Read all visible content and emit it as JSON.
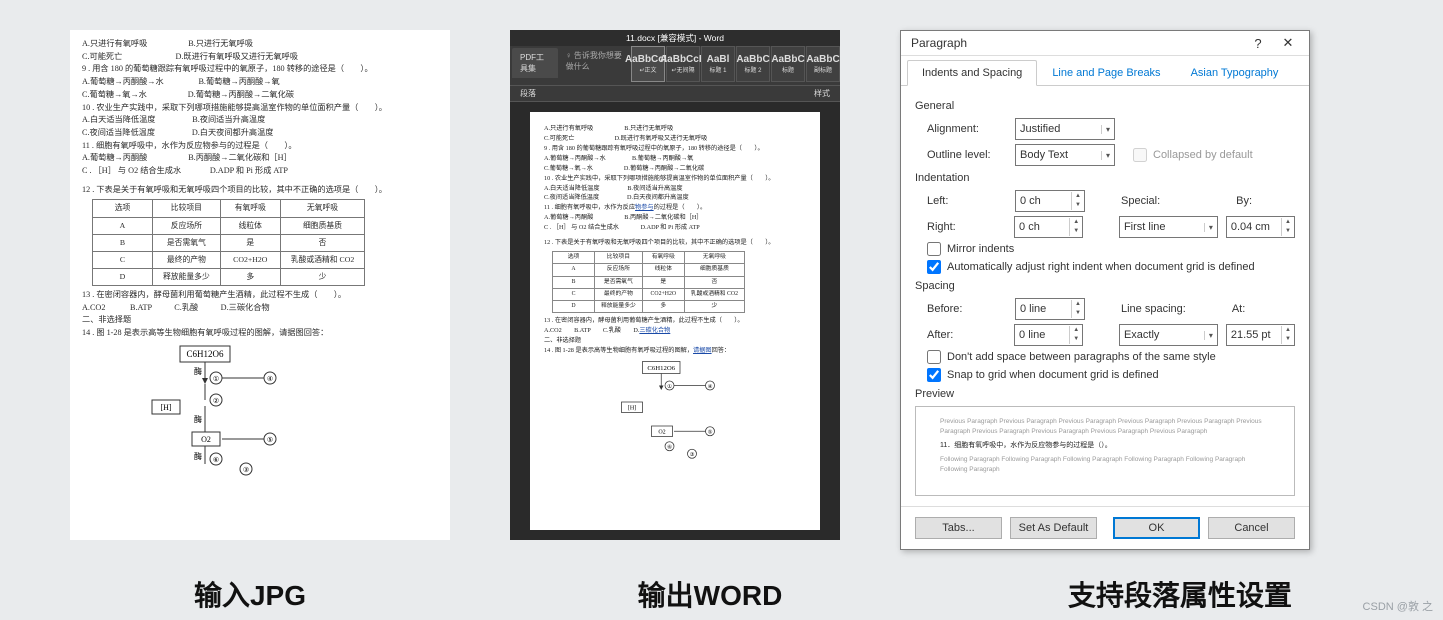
{
  "captions": {
    "jpg": "输入JPG",
    "word": "输出WORD",
    "dialog": "支持段落属性设置"
  },
  "watermark": "CSDN @敦 之",
  "doc": {
    "l1": "A.只进行有氧呼吸                    B.只进行无氧呼吸",
    "l2": "C.可能死亡                          D.既进行有氧呼吸又进行无氧呼吸",
    "l3": "9 . 用含 180 的葡萄糖跟踪有氧呼吸过程中的氧原子，180 转移的途径是（　　）。",
    "l4": "A.葡萄糖→丙酮酸→水                 B.葡萄糖→丙酮酸→氧",
    "l5": "C.葡萄糖→氧→水                    D.葡萄糖→丙酮酸→二氧化碳",
    "l6": "10 . 农业生产实践中，采取下列哪项措施能够提高温室作物的单位面积产量（　　）。",
    "l7": "A.白天适当降低温度                  B.夜间适当升高温度",
    "l8": "C.夜间适当降低温度                  D.白天夜间都升高温度",
    "l9": "11 . 细胞有氧呼吸中，水作为反应物参与的过程是（　　）。",
    "l10": "A.葡萄糖→丙酮酸                    B.丙酮酸→二氧化碳和［H］",
    "l11": "C . ［H］ 与 O2 结合生成水              D.ADP 和 Pi 形成 ATP",
    "l12": "12 . 下表是关于有氧呼吸和无氧呼吸四个项目的比较，其中不正确的选项是（　　）。",
    "th": [
      "选项",
      "比较项目",
      "有氧呼吸",
      "无氧呼吸"
    ],
    "tA": [
      "A",
      "反应场所",
      "线粒体",
      "细胞质基质"
    ],
    "tB": [
      "B",
      "是否需氧气",
      "是",
      "否"
    ],
    "tC": [
      "C",
      "最终的产物",
      "CO2+H2O",
      "乳酸或酒精和 CO2"
    ],
    "tD": [
      "D",
      "释放能量多少",
      "多",
      "少"
    ],
    "l13": "13 . 在密闭容器内，酵母菌利用葡萄糖产生酒精，此过程不生成（　　）。",
    "l14": "A.CO2            B.ATP           C.乳酸           D.三碳化合物",
    "l15": "二、非选择题",
    "l16": "14 . 图 1-28 是表示高等生物细胞有氧呼吸过程的图解，请据图回答：",
    "diagram_labels": {
      "top": "C6H12O6",
      "enzyme": "酶",
      "o2": "O2",
      "h": "[H]",
      "n1": "①",
      "n2": "②",
      "n3": "③",
      "n4": "④",
      "n5": "⑤",
      "n6": "⑥"
    }
  },
  "word": {
    "title": "11.docx [兼容模式] - Word",
    "tab_pdf": "PDF工具集",
    "tell_me": "♀ 告诉我你想要做什么",
    "styles": [
      {
        "sample": "AaBbCcD",
        "label": "↵正文"
      },
      {
        "sample": "AaBbCcD",
        "label": "↵无间隔"
      },
      {
        "sample": "AaBl",
        "label": "标题 1"
      },
      {
        "sample": "AaBbC",
        "label": "标题 2"
      },
      {
        "sample": "AaBbC",
        "label": "标题"
      },
      {
        "sample": "AaBbC",
        "label": "副标题"
      }
    ],
    "subbar_l": "段落",
    "subbar_r": "样式",
    "linked1": "物参与",
    "linked2": "三碳化合物",
    "linked3": "请据图"
  },
  "dialog": {
    "title": "Paragraph",
    "help": "?",
    "close": "✕",
    "tabs": [
      "Indents and Spacing",
      "Line and Page Breaks",
      "Asian Typography"
    ],
    "general": "General",
    "alignment_label": "Alignment:",
    "alignment_val": "Justified",
    "outline_label": "Outline level:",
    "outline_val": "Body Text",
    "collapsed": "Collapsed by default",
    "indentation": "Indentation",
    "left_label": "Left:",
    "left_val": "0 ch",
    "right_label": "Right:",
    "right_val": "0 ch",
    "special_label": "Special:",
    "special_val": "First line",
    "by_label": "By:",
    "by_val": "0.04 cm",
    "mirror": "Mirror indents",
    "autoright": "Automatically adjust right indent when document grid is defined",
    "spacing": "Spacing",
    "before_label": "Before:",
    "before_val": "0 line",
    "after_label": "After:",
    "after_val": "0 line",
    "linespacing_label": "Line spacing:",
    "linespacing_val": "Exactly",
    "at_label": "At:",
    "at_val": "21.55 pt",
    "noadd": "Don't add space between paragraphs of the same style",
    "snap": "Snap to grid when document grid is defined",
    "preview_title": "Preview",
    "preview_prev": "Previous Paragraph Previous Paragraph Previous Paragraph Previous Paragraph Previous Paragraph Previous Paragraph Previous Paragraph Previous Paragraph Previous Paragraph Previous Paragraph",
    "preview_current": "11．细胞有氧呼吸中，水作为反应物参与的过程是（）。",
    "preview_next": "Following Paragraph Following Paragraph Following Paragraph Following Paragraph Following Paragraph Following Paragraph",
    "btn_tabs": "Tabs...",
    "btn_default": "Set As Default",
    "btn_ok": "OK",
    "btn_cancel": "Cancel"
  }
}
